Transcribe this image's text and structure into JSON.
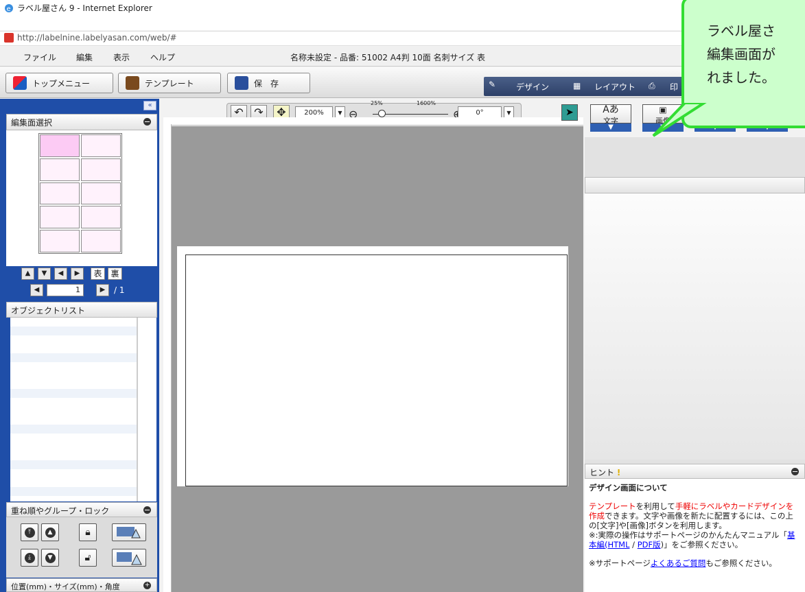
{
  "window": {
    "title": "ラベル屋さん 9 - Internet Explorer",
    "url": "http://labelnine.labelyasan.com/web/#"
  },
  "menu": {
    "items": [
      "ファイル",
      "編集",
      "表示",
      "ヘルプ"
    ],
    "doc_info": "名称未設定 - 品番: 51002 A4判 10面 名刺サイズ 表"
  },
  "toolbar": {
    "top_menu": "トップメニュー",
    "template": "テンプレート",
    "save": "保　存",
    "modes": [
      "デザイン",
      "レイアウト",
      "印"
    ]
  },
  "left": {
    "face_select_title": "編集面選択",
    "face_front": "表",
    "face_back": "裏",
    "page_current": "1",
    "page_total": "/ 1",
    "object_list_title": "オブジェクトリスト",
    "order_group_title": "重ね順やグループ・ロック",
    "position_title": "位置(mm)・サイズ(mm)・角度"
  },
  "zoom": {
    "value": "200%",
    "min_label": "25%",
    "max_label": "1600%",
    "angle": "0°"
  },
  "insert": {
    "text_label": "文字",
    "image_label": "画像"
  },
  "hint": {
    "title": "ヒント",
    "heading": "デザイン画面について",
    "p1_red1": "テンプレート",
    "p1_a": "を利用して",
    "p1_red2": "手軽にラベルやカードデザインを作成",
    "p1_b": "できます。文字や画像を新たに配置するには、この上の[文字]や[画像]ボタンを利用します。",
    "p2": "※:実際の操作はサポートページのかんたんマニュアル「",
    "link_html": "基本編(HTML",
    "sep": " / ",
    "link_pdf": "PDF版",
    "p2_end": ")」をご参照ください。",
    "p3_a": "※サポートページ",
    "link_faq": "よくあるご質問",
    "p3_b": "もご参照ください。"
  },
  "callout": {
    "lines": [
      "ラベル屋さ",
      "編集画面が",
      "れました。"
    ]
  },
  "colors": {
    "panel_blue": "#1f4ea8",
    "callout_green": "#33dd33",
    "callout_fill": "#ccffcc"
  }
}
